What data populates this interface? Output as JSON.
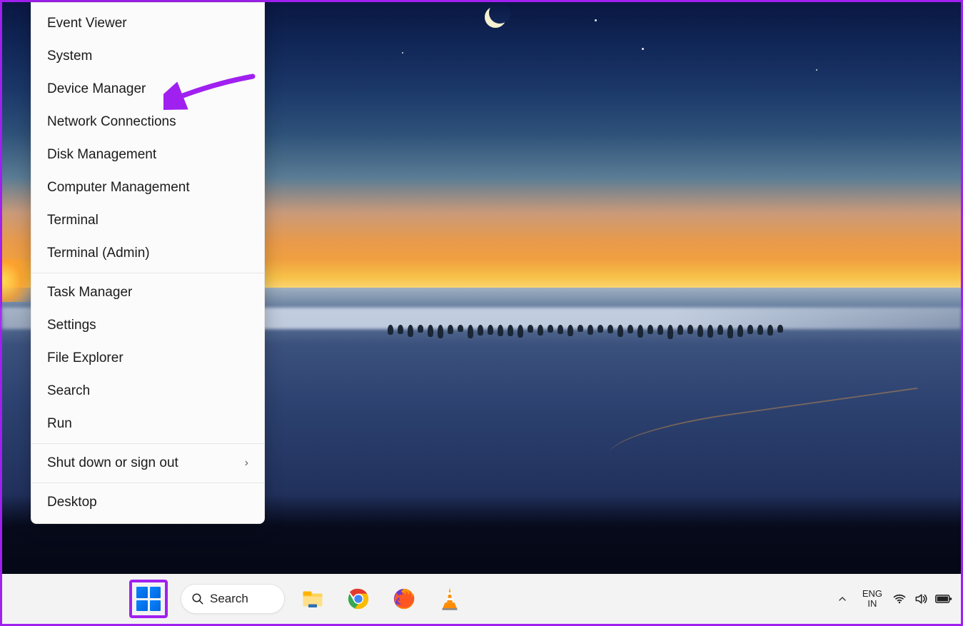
{
  "menu": {
    "groups": [
      [
        "Event Viewer",
        "System",
        "Device Manager",
        "Network Connections",
        "Disk Management",
        "Computer Management",
        "Terminal",
        "Terminal (Admin)"
      ],
      [
        "Task Manager",
        "Settings",
        "File Explorer",
        "Search",
        "Run"
      ],
      [
        "Shut down or sign out"
      ],
      [
        "Desktop"
      ]
    ],
    "submenu_items": [
      "Shut down or sign out"
    ]
  },
  "annotation": {
    "target_item": "Device Manager",
    "highlight_target": "start-button",
    "arrow_color": "#a020f0"
  },
  "search": {
    "label": "Search"
  },
  "taskbar_apps": [
    {
      "name": "file-explorer"
    },
    {
      "name": "chrome"
    },
    {
      "name": "firefox"
    },
    {
      "name": "vlc"
    }
  ],
  "tray": {
    "language": {
      "line1": "ENG",
      "line2": "IN"
    },
    "icons": [
      "wifi",
      "volume",
      "battery"
    ]
  }
}
